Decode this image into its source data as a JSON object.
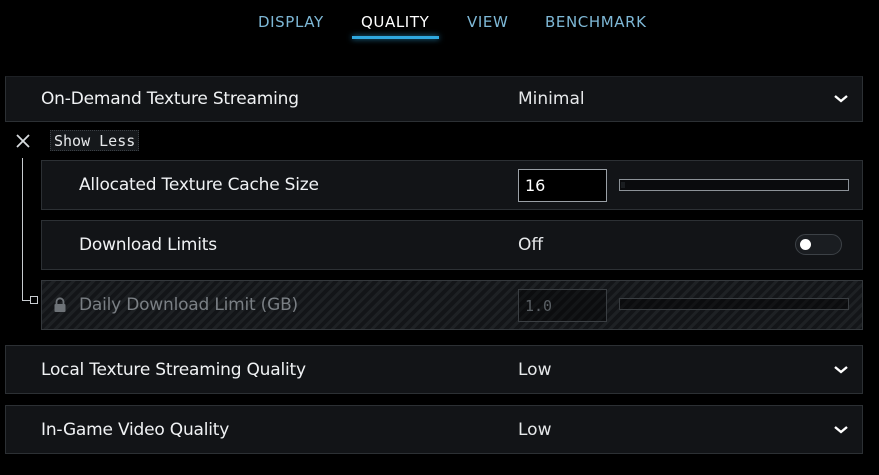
{
  "tabs": [
    {
      "label": "DISPLAY",
      "active": false
    },
    {
      "label": "QUALITY",
      "active": true
    },
    {
      "label": "VIEW",
      "active": false
    },
    {
      "label": "BENCHMARK",
      "active": false
    }
  ],
  "accent_color": "#2fa8e0",
  "settings": {
    "texture_streaming": {
      "label": "On-Demand Texture Streaming",
      "value": "Minimal",
      "icon": "chevron-down-icon"
    },
    "show_less": {
      "label": "Show Less",
      "icon": "close-icon"
    },
    "cache_size": {
      "label": "Allocated Texture Cache Size",
      "value": "16"
    },
    "download_limits": {
      "label": "Download Limits",
      "value": "Off",
      "toggle_on": false
    },
    "daily_limit": {
      "label": "Daily Download Limit (GB)",
      "value": "1.0",
      "disabled": true,
      "icon": "lock-icon"
    },
    "local_streaming": {
      "label": "Local Texture Streaming Quality",
      "value": "Low",
      "icon": "chevron-down-icon"
    },
    "video_quality": {
      "label": "In-Game Video Quality",
      "value": "Low",
      "icon": "chevron-down-icon"
    }
  }
}
